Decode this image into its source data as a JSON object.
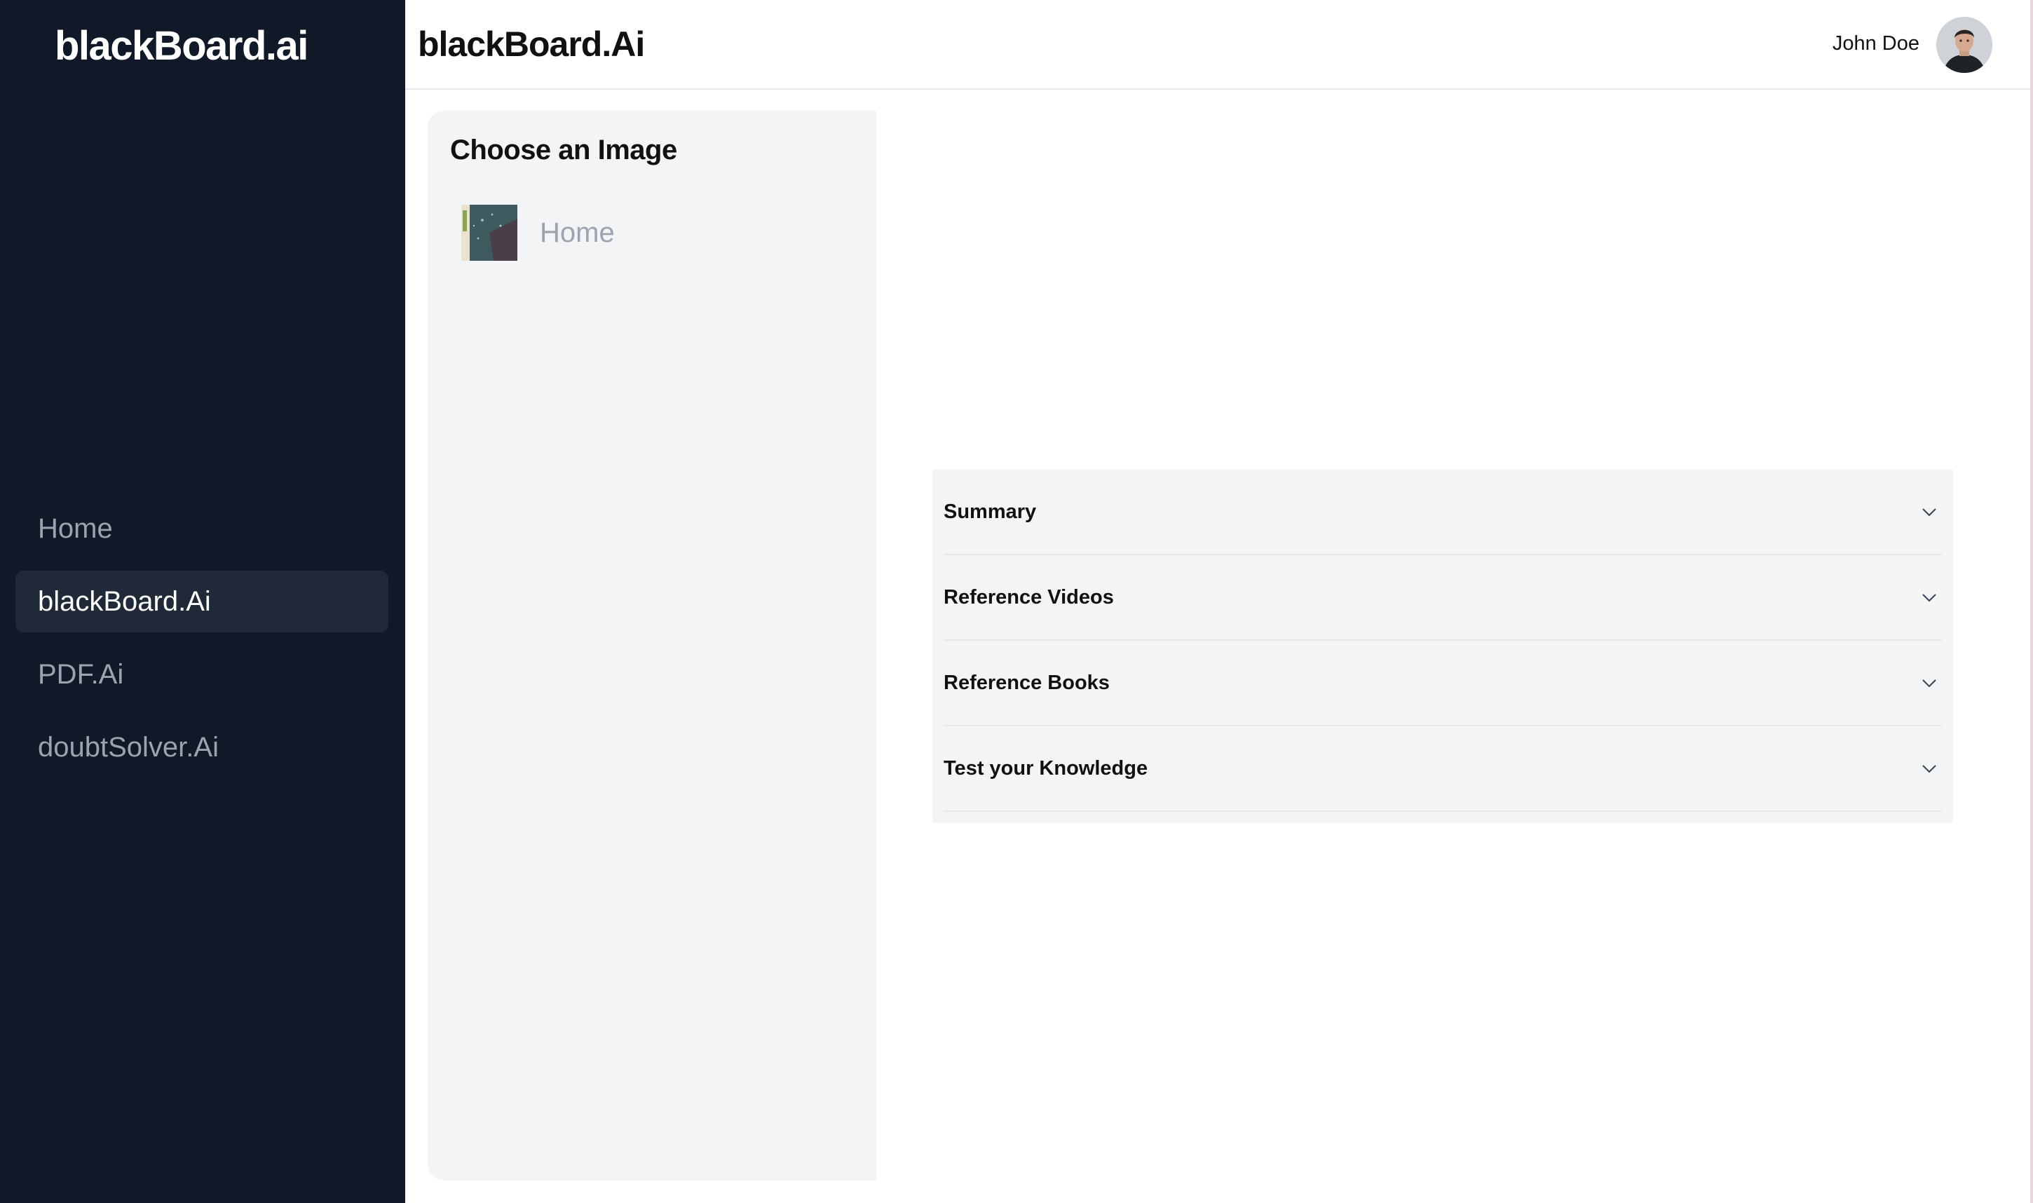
{
  "sidebar": {
    "brand": "blackBoard.ai",
    "items": [
      {
        "label": "Home",
        "active": false
      },
      {
        "label": "blackBoard.Ai",
        "active": true
      },
      {
        "label": "PDF.Ai",
        "active": false
      },
      {
        "label": "doubtSolver.Ai",
        "active": false
      }
    ]
  },
  "header": {
    "title": "blackBoard.Ai",
    "user_name": "John Doe",
    "avatar_icon": "user-avatar-photo"
  },
  "chooser": {
    "title": "Choose an Image",
    "items": [
      {
        "label": "Home",
        "thumbnail_icon": "image-thumbnail"
      }
    ]
  },
  "accordion": {
    "items": [
      {
        "label": "Summary",
        "icon": "chevron-down-icon"
      },
      {
        "label": "Reference Videos",
        "icon": "chevron-down-icon"
      },
      {
        "label": "Reference Books",
        "icon": "chevron-down-icon"
      },
      {
        "label": "Test your Knowledge",
        "icon": "chevron-down-icon"
      }
    ]
  },
  "colors": {
    "sidebar_bg": "#111827",
    "sidebar_active_bg": "#1f2937",
    "panel_bg": "#f3f4f6",
    "muted_text": "#9ca3af"
  }
}
